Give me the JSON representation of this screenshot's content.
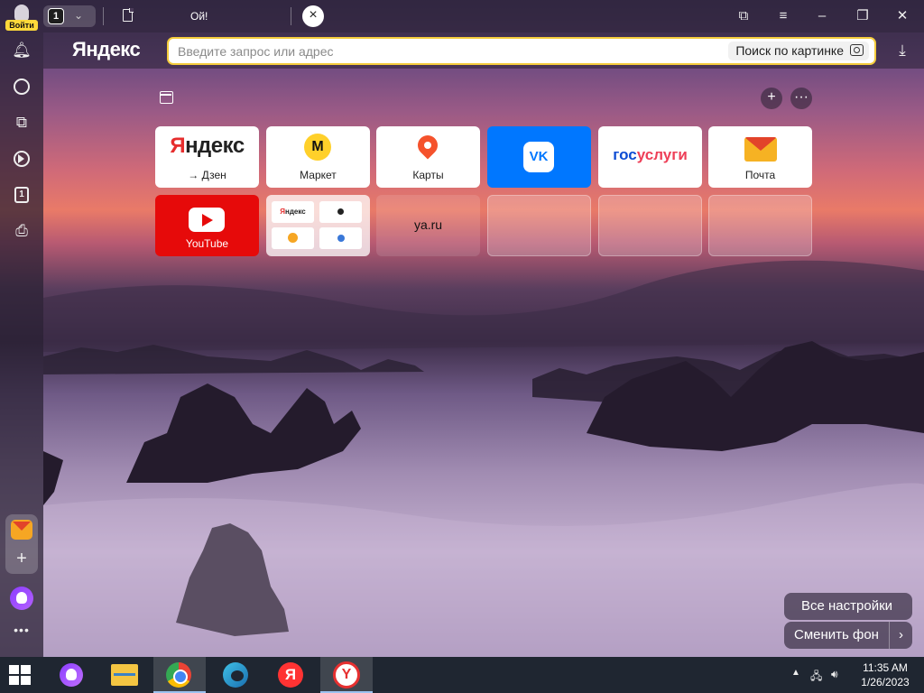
{
  "titlebar": {
    "login_label": "Войти",
    "tab_count": "1",
    "active_tab_title": "Ой!"
  },
  "addressbar": {
    "logo_text": "Яндекс",
    "placeholder": "Введите запрос или адрес",
    "image_search_label": "Поиск по картинке"
  },
  "tiles": [
    {
      "id": "yandex",
      "label": "→ Дзен"
    },
    {
      "id": "market",
      "label": "Маркет"
    },
    {
      "id": "maps",
      "label": "Карты"
    },
    {
      "id": "vk",
      "label": ""
    },
    {
      "id": "gosuslugi",
      "label": ""
    },
    {
      "id": "pochta",
      "label": "Почта"
    },
    {
      "id": "youtube",
      "label": "YouTube"
    },
    {
      "id": "group",
      "label": ""
    },
    {
      "id": "ya",
      "label": "ya.ru"
    }
  ],
  "tile_texts": {
    "yandex_word_y": "Я",
    "yandex_word_rest": "ндекс",
    "vk_logo": "VK",
    "gos_word_a": "гос",
    "gos_word_b": "услуги",
    "group_mini_yandex_y": "Я",
    "group_mini_yandex_rest": "ндекс"
  },
  "bottom_buttons": {
    "all_settings": "Все настройки",
    "change_background": "Сменить фон"
  },
  "taskbar": {
    "time": "11:35 AM",
    "date": "1/26/2023",
    "ya_letter": "Я",
    "yb_letter": "Y"
  },
  "colors": {
    "accent_yellow": "#f4cc3c",
    "vk_blue": "#0077ff",
    "youtube_red": "#e60a0a"
  }
}
